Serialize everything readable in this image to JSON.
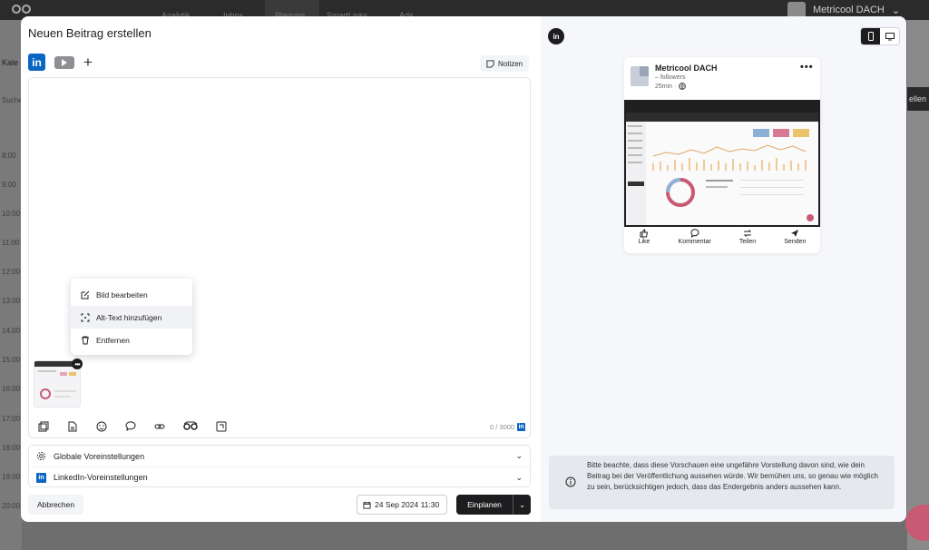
{
  "background": {
    "nav_items": [
      "Analytik",
      "Inbox",
      "Planung",
      "SmartLinks",
      "Ads"
    ],
    "brand": "Metricool DACH",
    "brand_badge": "me bri cool",
    "left_labels": [
      "Kale",
      "Suche"
    ],
    "times": [
      "8:00",
      "9:00",
      "10:00",
      "11:00",
      "12:00",
      "13:00",
      "14:00",
      "15:00",
      "16:00",
      "17:00",
      "18:00",
      "19:00",
      "20:00"
    ],
    "right_button": "ellen"
  },
  "modal": {
    "title": "Neuen Beitrag erstellen",
    "notes_label": "Notizen",
    "counter": "0 / 3000",
    "context_menu": [
      {
        "label": "Bild bearbeiten",
        "icon": "edit-icon"
      },
      {
        "label": "Alt-Text hinzufügen",
        "icon": "alt-text-icon"
      },
      {
        "label": "Entfernen",
        "icon": "trash-icon"
      }
    ],
    "settings": [
      {
        "label": "Globale Voreinstellungen",
        "icon": "gear-icon"
      },
      {
        "label": "LinkedIn-Voreinstellungen",
        "icon": "linkedin-icon"
      }
    ],
    "cancel_label": "Abbrechen",
    "date_label": "24 Sep 2024 11:30",
    "schedule_label": "Einplanen"
  },
  "preview": {
    "author": "Metricool DACH",
    "followers": "– followers",
    "time": "25min ·",
    "actions": [
      {
        "label": "Like",
        "icon": "like-icon"
      },
      {
        "label": "Kommentar",
        "icon": "comment-icon"
      },
      {
        "label": "Teilen",
        "icon": "repost-icon"
      },
      {
        "label": "Senden",
        "icon": "send-icon"
      }
    ],
    "notice": "Bitte beachte, dass diese Vorschauen eine ungefähre Vorstellung davon sind, wie dein Beitrag bei der Veröffentlichung aussehen würde. Wir bemühen uns, so genau wie möglich zu sein, berücksichtigen jedoch, dass das Endergebnis anders aussehen kann."
  },
  "colors": {
    "linkedin": "#0a66c2",
    "primary_dark": "#1d1d1f",
    "chat": "#c95a74"
  }
}
